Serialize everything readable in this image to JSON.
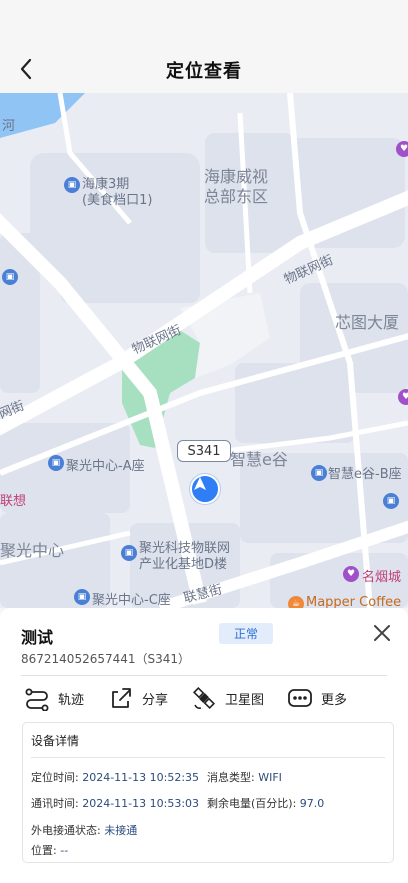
{
  "header": {
    "title": "定位查看",
    "back_icon": "chevron-left-icon"
  },
  "map": {
    "labels": {
      "river": "河",
      "haikang3": "海康3期",
      "meishi": "(美食档口1)",
      "hikvision_hq_1": "海康威视",
      "hikvision_hq_2": "总部东区",
      "wulianwang_st_1": "物联网街",
      "wulianwang_st_2": "物联网街",
      "xintu": "芯图大厦",
      "wang": "网街",
      "zhihui_egu": "智慧e谷",
      "zhihui_egu_b": "智慧e谷-B座",
      "jg_a": "聚光中心-A座",
      "lianxiang": "联想",
      "jg_center": "聚光中心",
      "jg_tech_1": "聚光科技物联网",
      "jg_tech_2": "产业化基地D楼",
      "jg_c": "聚光中心-C座",
      "lianhui": "联慧街",
      "mingyan": "名烟城",
      "mapper": "Mapper Coffee"
    },
    "road_badge": "S341",
    "marker_icon": "navigation-arrow-icon",
    "colors": {
      "background": "#e9ecf3",
      "block": "#dde2ec",
      "road": "#ffffff",
      "water": "#8fc4f5",
      "park": "#a7e0c0"
    }
  },
  "device": {
    "name": "测试",
    "status": "正常",
    "imei": "867214052657441（S341）"
  },
  "actions": [
    {
      "label": "轨迹",
      "icon": "track-route-icon"
    },
    {
      "label": "分享",
      "icon": "share-icon"
    },
    {
      "label": "卫星图",
      "icon": "satellite-icon"
    },
    {
      "label": "更多",
      "icon": "more-icon"
    }
  ],
  "details": {
    "title": "设备详情",
    "locate_time_key": "定位时间:",
    "locate_time_val": "2024-11-13 10:52:35",
    "msg_type_key": "消息类型:",
    "msg_type_val": "WIFI",
    "comm_time_key": "通讯时间:",
    "comm_time_val": "2024-11-13 10:53:03",
    "battery_key": "剩余电量(百分比):",
    "battery_val": "97.0",
    "power_key": "外电接通状态:",
    "power_val": "未接通",
    "position_key": "位置:",
    "position_val": "--"
  },
  "accent_color": "#2f7ef5"
}
